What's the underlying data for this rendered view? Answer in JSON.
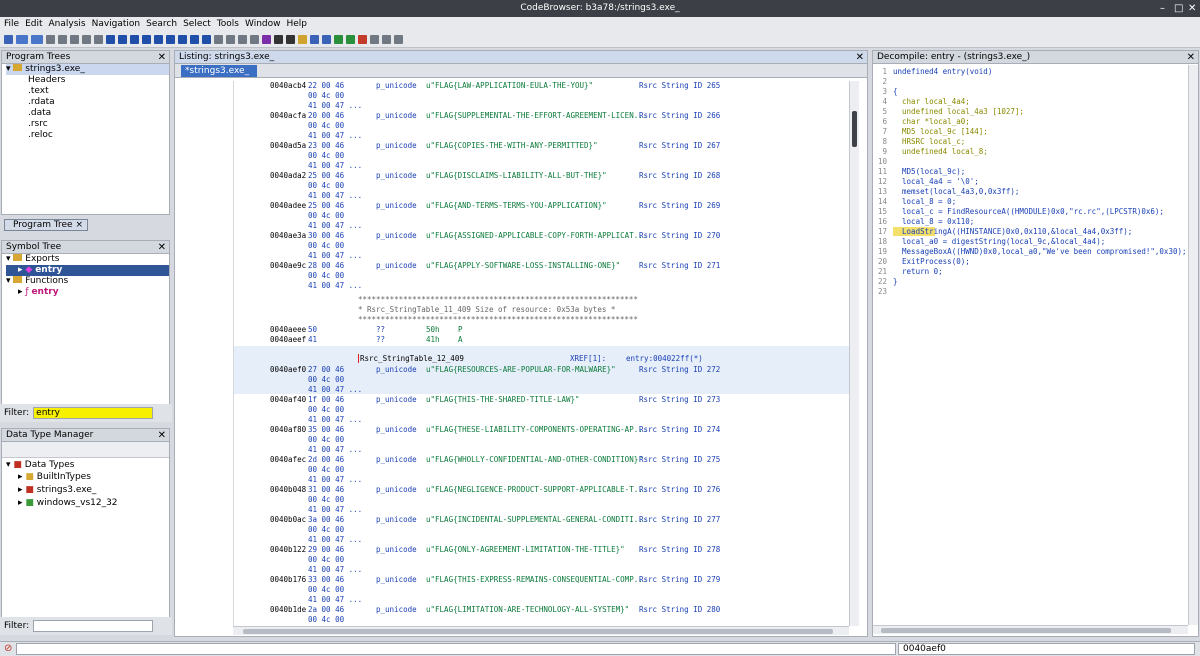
{
  "window": {
    "title": "CodeBrowser: b3a78:/strings3.exe_",
    "min": "–",
    "max": "□",
    "close": "✕"
  },
  "menu": [
    "File",
    "Edit",
    "Analysis",
    "Navigation",
    "Search",
    "Select",
    "Tools",
    "Window",
    "Help"
  ],
  "program_trees": {
    "title": "Program Trees",
    "root": "strings3.exe_",
    "sections": [
      "Headers",
      ".text",
      ".rdata",
      ".data",
      ".rsrc",
      ".reloc"
    ],
    "tab": "Program Tree"
  },
  "symbol_tree": {
    "title": "Symbol Tree",
    "exports": "Exports",
    "export_entry": "entry",
    "functions": "Functions",
    "function_entry": "entry",
    "filter_label": "Filter:",
    "filter_value": "entry"
  },
  "data_type_manager": {
    "title": "Data Type Manager",
    "root": "Data Types",
    "items": [
      "BuiltInTypes",
      "strings3.exe_",
      "windows_vs12_32"
    ],
    "filter_label": "Filter:"
  },
  "listing": {
    "title": "Listing:  strings3.exe_",
    "tab": "*strings3.exe_",
    "rows": [
      {
        "addr": "0040acb4",
        "b": "22 00 46",
        "m": "p_unicode",
        "s": "u\"FLAG{LAW-APPLICATION-EULA-THE-YOU}\"",
        "c": "Rsrc String ID 265"
      },
      {
        "addr": "0040acfa",
        "b": "20 00 46",
        "m": "p_unicode",
        "s": "u\"FLAG{SUPPLEMENTAL-THE-EFFORT-AGREEMENT-LICEN...",
        "c": "Rsrc String ID 266"
      },
      {
        "addr": "0040ad5a",
        "b": "23 00 46",
        "m": "p_unicode",
        "s": "u\"FLAG{COPIES-THE-WITH-ANY-PERMITTED}\"",
        "c": "Rsrc String ID 267"
      },
      {
        "addr": "0040ada2",
        "b": "25 00 46",
        "m": "p_unicode",
        "s": "u\"FLAG{DISCLAIMS-LIABILITY-ALL-BUT-THE}\"",
        "c": "Rsrc String ID 268"
      },
      {
        "addr": "0040adee",
        "b": "25 00 46",
        "m": "p_unicode",
        "s": "u\"FLAG{AND-TERMS-TERMS-YOU-APPLICATION}\"",
        "c": "Rsrc String ID 269"
      },
      {
        "addr": "0040ae3a",
        "b": "30 00 46",
        "m": "p_unicode",
        "s": "u\"FLAG{ASSIGNED-APPLICABLE-COPY-FORTH-APPLICAT...",
        "c": "Rsrc String ID 270"
      },
      {
        "addr": "0040ae9c",
        "b": "28 00 46",
        "m": "p_unicode",
        "s": "u\"FLAG{APPLY-SOFTWARE-LOSS-INSTALLING-ONE}\"",
        "c": "Rsrc String ID 271"
      }
    ],
    "cont1": "00 4c 00",
    "cont2": "41 00 47 ...",
    "banner_stars": "**************************************************************",
    "banner_text": "* Rsrc_StringTable_11_409 Size of resource: 0x53a bytes       *",
    "byte_rows": [
      {
        "addr": "0040aeee",
        "b": "50",
        "m": "??",
        "v": "50h",
        "ch": "P"
      },
      {
        "addr": "0040aeef",
        "b": "41",
        "m": "??",
        "v": "41h",
        "ch": "A"
      }
    ],
    "label": "Rsrc_StringTable_12_409",
    "xref": "XREF[1]:",
    "xref_target": "entry:004022ff(*)",
    "rows2": [
      {
        "addr": "0040aef0",
        "b": "27 00 46",
        "m": "p_unicode",
        "s": "u\"FLAG{RESOURCES-ARE-POPULAR-FOR-MALWARE}\"",
        "c": "Rsrc String ID 272"
      },
      {
        "addr": "0040af40",
        "b": "1f 00 46",
        "m": "p_unicode",
        "s": "u\"FLAG{THIS-THE-SHARED-TITLE-LAW}\"",
        "c": "Rsrc String ID 273"
      },
      {
        "addr": "0040af80",
        "b": "35 00 46",
        "m": "p_unicode",
        "s": "u\"FLAG{THESE-LIABILITY-COMPONENTS-OPERATING-AP...",
        "c": "Rsrc String ID 274"
      },
      {
        "addr": "0040afec",
        "b": "2d 00 46",
        "m": "p_unicode",
        "s": "u\"FLAG{WHOLLY-CONFIDENTIAL-AND-OTHER-CONDITION}\"",
        "c": "Rsrc String ID 275"
      },
      {
        "addr": "0040b048",
        "b": "31 00 46",
        "m": "p_unicode",
        "s": "u\"FLAG{NEGLIGENCE-PRODUCT-SUPPORT-APPLICABLE-T...",
        "c": "Rsrc String ID 276"
      },
      {
        "addr": "0040b0ac",
        "b": "3a 00 46",
        "m": "p_unicode",
        "s": "u\"FLAG{INCIDENTAL-SUPPLEMENTAL-GENERAL-CONDITI...",
        "c": "Rsrc String ID 277"
      },
      {
        "addr": "0040b122",
        "b": "29 00 46",
        "m": "p_unicode",
        "s": "u\"FLAG{ONLY-AGREEMENT-LIMITATION-THE-TITLE}\"",
        "c": "Rsrc String ID 278"
      },
      {
        "addr": "0040b176",
        "b": "33 00 46",
        "m": "p_unicode",
        "s": "u\"FLAG{THIS-EXPRESS-REMAINS-CONSEQUENTIAL-COMP...",
        "c": "Rsrc String ID 279"
      },
      {
        "addr": "0040b1de",
        "b": "2a 00 46",
        "m": "p_unicode",
        "s": "u\"FLAG{LIMITATION-ARE-TECHNOLOGY-ALL-SYSTEM}\"",
        "c": "Rsrc String ID 280"
      }
    ]
  },
  "decompile": {
    "title": "Decompile: entry - (strings3.exe_)",
    "lines": [
      "undefined4 entry(void)",
      "",
      "{",
      "  char local_4a4;",
      "  undefined local_4a3 [1027];",
      "  char *local_a0;",
      "  MD5 local_9c [144];",
      "  HRSRC local_c;",
      "  undefined4 local_8;",
      "",
      "  MD5(local_9c);",
      "  local_4a4 = '\\0';",
      "  memset(local_4a3,0,0x3ff);",
      "  local_8 = 0;",
      "  local_c = FindResourceA((HMODULE)0x0,\"rc.rc\",(LPCSTR)0x6);",
      "  local_8 = 0x110;",
      "  LoadStringA((HINSTANCE)0x0,0x110,&local_4a4,0x3ff);",
      "  local_a0 = digestString(local_9c,&local_4a4);",
      "  MessageBoxA((HWND)0x0,local_a0,\"We've been compromised!\",0x30);",
      "  ExitProcess(0);",
      "  return 0;",
      "}",
      ""
    ]
  },
  "status": {
    "address": "0040aef0"
  }
}
